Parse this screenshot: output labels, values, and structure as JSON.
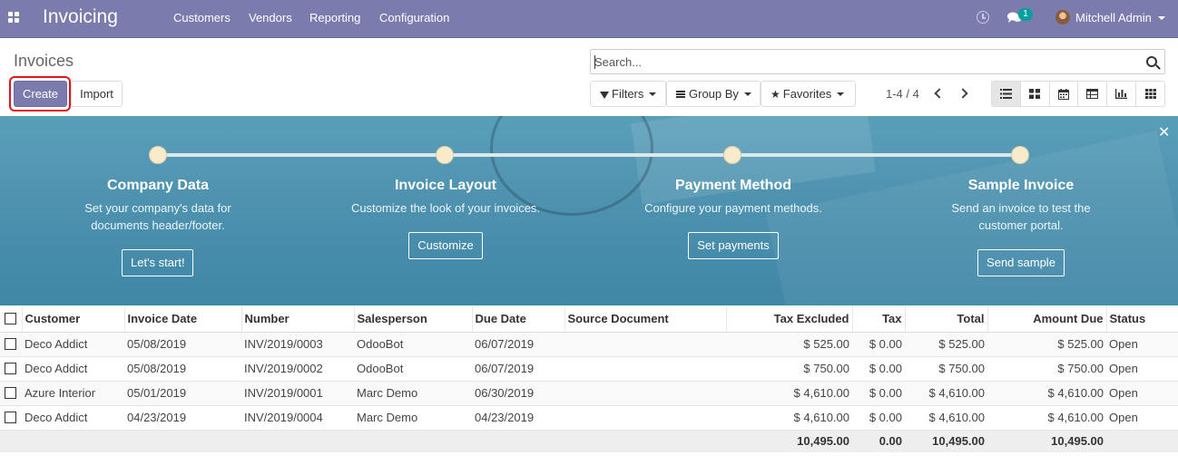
{
  "navbar": {
    "app_title": "Invoicing",
    "menu": [
      "Customers",
      "Vendors",
      "Reporting",
      "Configuration"
    ],
    "chat_badge": "1",
    "user_name": "Mitchell Admin"
  },
  "control_panel": {
    "breadcrumb": "Invoices",
    "create_label": "Create",
    "import_label": "Import",
    "search_placeholder": "Search...",
    "filters_label": "Filters",
    "group_by_label": "Group By",
    "favorites_label": "Favorites",
    "pager_value": "1-4 / 4",
    "active_view": "list"
  },
  "banner": {
    "steps": [
      {
        "title": "Company Data",
        "desc": [
          "Set your company's data for",
          "documents header/footer."
        ],
        "button": "Let's start!"
      },
      {
        "title": "Invoice Layout",
        "desc": [
          "Customize the look of your invoices."
        ],
        "button": "Customize"
      },
      {
        "title": "Payment Method",
        "desc": [
          "Configure your payment methods."
        ],
        "button": "Set payments"
      },
      {
        "title": "Sample Invoice",
        "desc": [
          "Send an invoice to test the",
          "customer portal."
        ],
        "button": "Send sample"
      }
    ]
  },
  "table": {
    "columns": [
      "Customer",
      "Invoice Date",
      "Number",
      "Salesperson",
      "Due Date",
      "Source Document",
      "Tax Excluded",
      "Tax",
      "Total",
      "Amount Due",
      "Status"
    ],
    "rows": [
      [
        "Deco Addict",
        "05/08/2019",
        "INV/2019/0003",
        "OdooBot",
        "06/07/2019",
        "",
        "$ 525.00",
        "$ 0.00",
        "$ 525.00",
        "$ 525.00",
        "Open"
      ],
      [
        "Deco Addict",
        "05/08/2019",
        "INV/2019/0002",
        "OdooBot",
        "06/07/2019",
        "",
        "$ 750.00",
        "$ 0.00",
        "$ 750.00",
        "$ 750.00",
        "Open"
      ],
      [
        "Azure Interior",
        "05/01/2019",
        "INV/2019/0001",
        "Marc Demo",
        "06/30/2019",
        "",
        "$ 4,610.00",
        "$ 0.00",
        "$ 4,610.00",
        "$ 4,610.00",
        "Open"
      ],
      [
        "Deco Addict",
        "04/23/2019",
        "INV/2019/0004",
        "Marc Demo",
        "04/23/2019",
        "",
        "$ 4,610.00",
        "$ 0.00",
        "$ 4,610.00",
        "$ 4,610.00",
        "Open"
      ]
    ],
    "totals": {
      "tax_excluded": "10,495.00",
      "tax": "0.00",
      "total": "10,495.00",
      "amount_due": "10,495.00"
    }
  },
  "colors": {
    "navbar": "#7c7bad",
    "primary_button": "#7c7bad",
    "banner": "#4f93b0",
    "badge": "#00a09d",
    "highlight": "#e4141f"
  }
}
